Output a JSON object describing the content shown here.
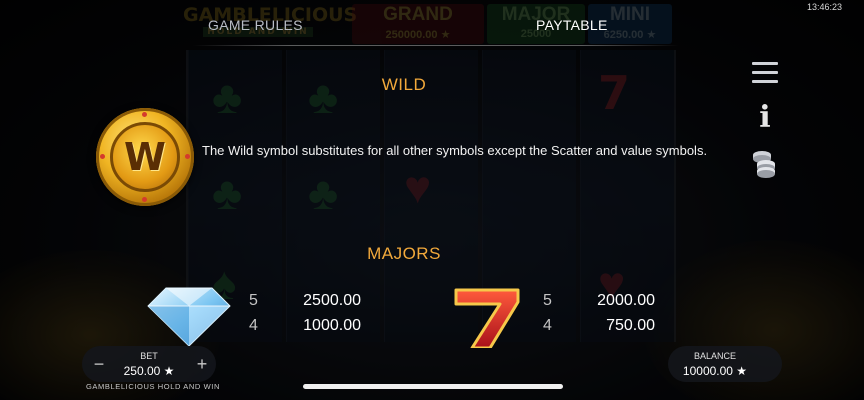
{
  "status": {
    "time": "13:46:23"
  },
  "background": {
    "logo_line1": "GAMBLELICIOUS",
    "logo_line2": "HOLD AND WIN",
    "jackpots": [
      {
        "title": "GRAND",
        "value": "250000.00 ★"
      },
      {
        "title": "MAJOR",
        "value": "25000"
      },
      {
        "title": "MINI",
        "value": "6250.00 ★"
      }
    ]
  },
  "tabs": {
    "rules_label": "GAME RULES",
    "paytable_label": "PAYTABLE",
    "active": "PAYTABLE"
  },
  "wild": {
    "title": "WILD",
    "coin_letter": "W",
    "description": "The Wild symbol substitutes for all other symbols except the Scatter and value symbols."
  },
  "majors": {
    "title": "MAJORS",
    "diamond": {
      "pays": [
        {
          "count": "5",
          "value": "2500.00"
        },
        {
          "count": "4",
          "value": "1000.00"
        }
      ]
    },
    "seven": {
      "pays": [
        {
          "count": "5",
          "value": "2000.00"
        },
        {
          "count": "4",
          "value": "750.00"
        }
      ]
    }
  },
  "side_menu": {
    "icons": [
      "menu-icon",
      "info-icon",
      "coins-icon"
    ]
  },
  "bottom": {
    "bet_label": "BET",
    "bet_value": "250.00 ★",
    "minus": "−",
    "plus": "+",
    "game_name": "GAMBLELICIOUS HOLD AND WIN",
    "balance_label": "BALANCE",
    "balance_value": "10000.00 ★"
  },
  "colors": {
    "section_title": "#f2a93b",
    "coin_gold": "#f0b523",
    "seven_red": "#d42a2a"
  }
}
